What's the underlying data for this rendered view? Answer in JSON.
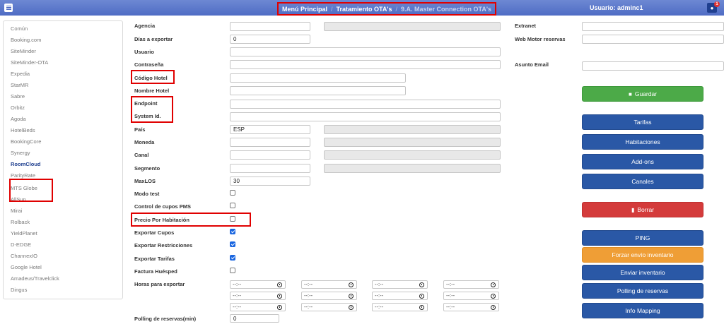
{
  "topbar": {
    "breadcrumb": [
      "Menú Principal",
      "Tratamiento OTA's",
      "9.A. Master Connection OTA's"
    ],
    "separator": "/",
    "user": "Usuario: adminc1",
    "notification_count": "1"
  },
  "sidebar": {
    "items": [
      "Común",
      "Booking.com",
      "SiteMinder",
      "SiteMinder-OTA",
      "Expedia",
      "StarMR",
      "Sabre",
      "Orbitz",
      "Agoda",
      "HotelBeds",
      "BookingCore",
      "Synergy",
      "RoomCloud",
      "ParityRate",
      "MTS Globe",
      "AllSun",
      "Mirai",
      "Rolback",
      "YieldPlanet",
      "D-EDGE",
      "ChannexIO",
      "Google Hotel",
      "Amadeus/Travelclick",
      "Dingus"
    ],
    "active": "RoomCloud"
  },
  "form": {
    "agencia": {
      "label": "Agencia",
      "value": ""
    },
    "dias": {
      "label": "Días a exportar",
      "value": "0"
    },
    "usuario": {
      "label": "Usuario",
      "value": ""
    },
    "contrasena": {
      "label": "Contraseña",
      "value": ""
    },
    "codigo_hotel": {
      "label": "Código Hotel",
      "value": ""
    },
    "nombre_hotel": {
      "label": "Nombre Hotel",
      "value": ""
    },
    "endpoint": {
      "label": "Endpoint",
      "value": ""
    },
    "system_id": {
      "label": "System Id.",
      "value": ""
    },
    "pais": {
      "label": "País",
      "value": "ESP"
    },
    "moneda": {
      "label": "Moneda",
      "value": ""
    },
    "canal": {
      "label": "Canal",
      "value": ""
    },
    "segmento": {
      "label": "Segmento",
      "value": ""
    },
    "maxlos": {
      "label": "MaxLOS",
      "value": "30"
    },
    "modo_test": {
      "label": "Modo test",
      "checked": false
    },
    "control_cupos": {
      "label": "Control de cupos PMS",
      "checked": false
    },
    "precio_habitacion": {
      "label": "Precio Por Habitación",
      "checked": false
    },
    "exportar_cupos": {
      "label": "Exportar Cupos",
      "checked": true
    },
    "exportar_restricciones": {
      "label": "Exportar Restricciones",
      "checked": true
    },
    "exportar_tarifas": {
      "label": "Exportar Tarifas",
      "checked": true
    },
    "factura_huesped": {
      "label": "Factura Huésped",
      "checked": false
    },
    "horas": {
      "label": "Horas para exportar",
      "placeholder": "--:--"
    },
    "polling": {
      "label": "Polling de reservas(min)",
      "value": "0"
    },
    "extranet": {
      "label": "Extranet",
      "value": ""
    },
    "web_motor": {
      "label": "Web Motor reservas",
      "value": ""
    },
    "asunto_email": {
      "label": "Asunto Email",
      "value": ""
    }
  },
  "buttons": {
    "guardar": "Guardar",
    "tarifas": "Tarifas",
    "habitaciones": "Habitaciones",
    "addons": "Add-ons",
    "canales": "Canales",
    "borrar": "Borrar",
    "ping": "PING",
    "forzar": "Forzar envío inventario",
    "enviar": "Enviar inventario",
    "polling": "Polling de reservas",
    "info_mapping": "Info Mapping"
  },
  "colors": {
    "topbar": "#5a77c9",
    "primary": "#2a58a6",
    "success": "#4caa48",
    "danger": "#d43b3b",
    "warning": "#ef9e36",
    "highlight": "#e00000"
  }
}
